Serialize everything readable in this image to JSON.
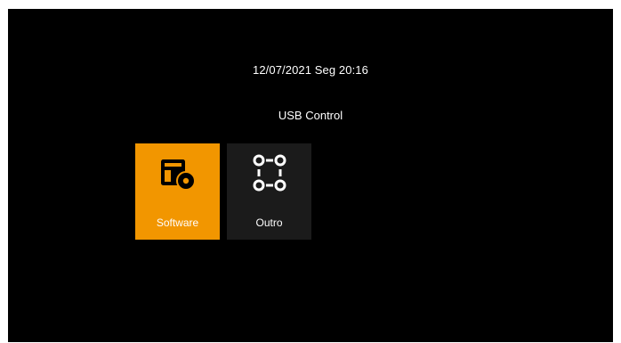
{
  "header": {
    "datetime": "12/07/2021 Seg 20:16",
    "menu_title": "USB Control"
  },
  "tiles": [
    {
      "label": "Software",
      "icon": "software-disk-icon",
      "selected": true
    },
    {
      "label": "Outro",
      "icon": "network-nodes-icon",
      "selected": false
    }
  ],
  "colors": {
    "background": "#000000",
    "selected_tile": "#F29600",
    "tile": "#1B1B1B",
    "text": "#FFFFFF"
  }
}
